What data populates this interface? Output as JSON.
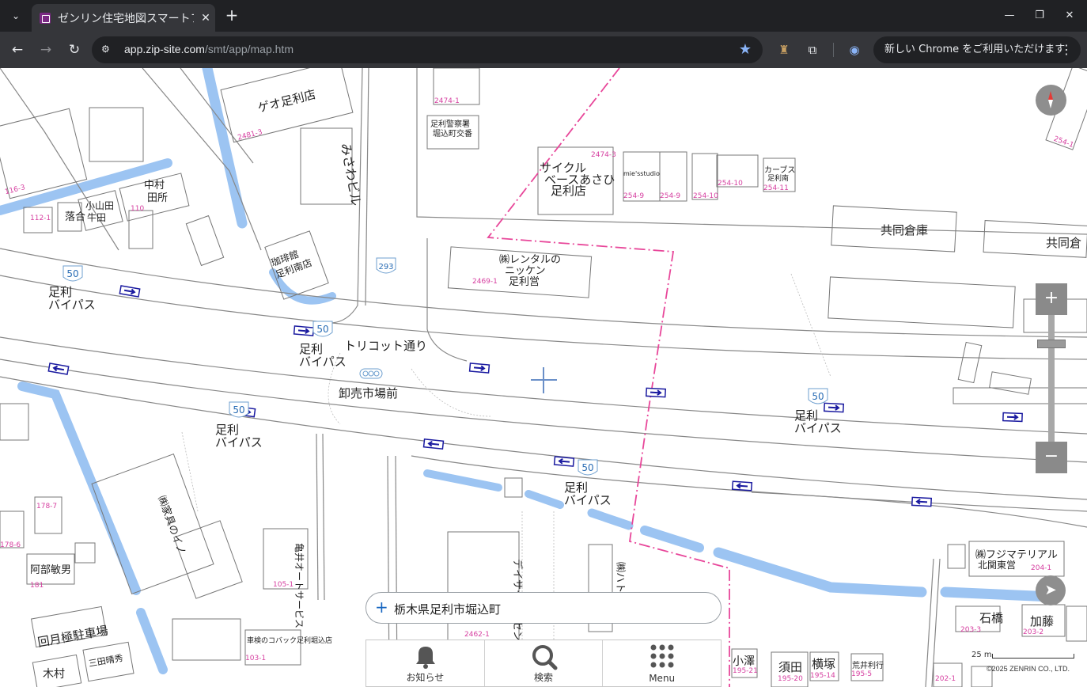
{
  "browser": {
    "tab_title": "ゼンリン住宅地図スマートフォン",
    "url_host": "app.zip-site.com",
    "url_path": "/smt/app/map.htm",
    "update_text": "新しい Chrome をご利用いただけます"
  },
  "map": {
    "address": "栃木県足利市堀込町",
    "scale_label": "25 m",
    "copyright": "©2025 ZENRIN CO., LTD.",
    "roads": {
      "bypass": "足利",
      "bypass2": "バイパス",
      "route_50": "50",
      "route_293": "293",
      "tricot": "トリコット通り",
      "market_mae": "卸売市場前"
    },
    "labels": {
      "geo": "ゲオ足利店",
      "misawa": "みさわビル",
      "cycle1": "サイクル",
      "cycle2": "ベースあさひ",
      "cycle3": "足利店",
      "rental1": "㈱レンタルの",
      "rental2": "ニッケン",
      "rental3": "足利営",
      "kyodo": "共同倉庫",
      "kyodo2": "共同倉",
      "police1": "足利警察署",
      "police2": "堀込町交番",
      "nakamura1": "中村",
      "nakamura2": "田所",
      "koyamada1": "小山田",
      "koyamada2": "牛田",
      "ochiai": "落合",
      "coffee1": "珈琲館",
      "coffee2": "足利南店",
      "kamei": "亀井オートサービス",
      "ietama": "㈱家具のイノ",
      "abe": "阿部敏男",
      "parking": "回月極駐車場",
      "kimura": "木村",
      "mita": "三田晴秀",
      "fuji1": "㈱フジマテリアル",
      "fuji2": "北関東営",
      "ishibashi": "石橋",
      "kato": "加藤",
      "koizawa": "小澤",
      "suda": "須田",
      "yokotsuka": "横塚",
      "arai": "荒井利行",
      "kasuga": "デイサービスセンター春日和",
      "hato": "㈱ハトダ",
      "carps1": "カーブス",
      "carps2": "足利南",
      "mies": "mie'sstudio",
      "shaken": "車検のコバック足利堀込店"
    },
    "lot_numbers": [
      "2474-1",
      "2474-3",
      "254-9",
      "254-10",
      "254-11",
      "2469-1",
      "2481-3",
      "116-3",
      "112-1",
      "110",
      "178-7",
      "178-6",
      "181",
      "105-1",
      "103-1",
      "2462-1",
      "203-3",
      "203-2",
      "204-1",
      "195-21",
      "195-20",
      "195-14",
      "195-5",
      "202-1",
      "254-1"
    ],
    "colors": {
      "boundary": "#e8479a",
      "water": "#9cc4f2",
      "road_outline": "#888888",
      "lot_number": "#d63fa0"
    }
  },
  "controls": {
    "zoom_in": "+",
    "zoom_out": "−",
    "menu": [
      {
        "label": "お知らせ",
        "icon": "bell-icon"
      },
      {
        "label": "検索",
        "icon": "search-icon"
      },
      {
        "label": "Menu",
        "icon": "grid-dots-icon"
      }
    ]
  }
}
